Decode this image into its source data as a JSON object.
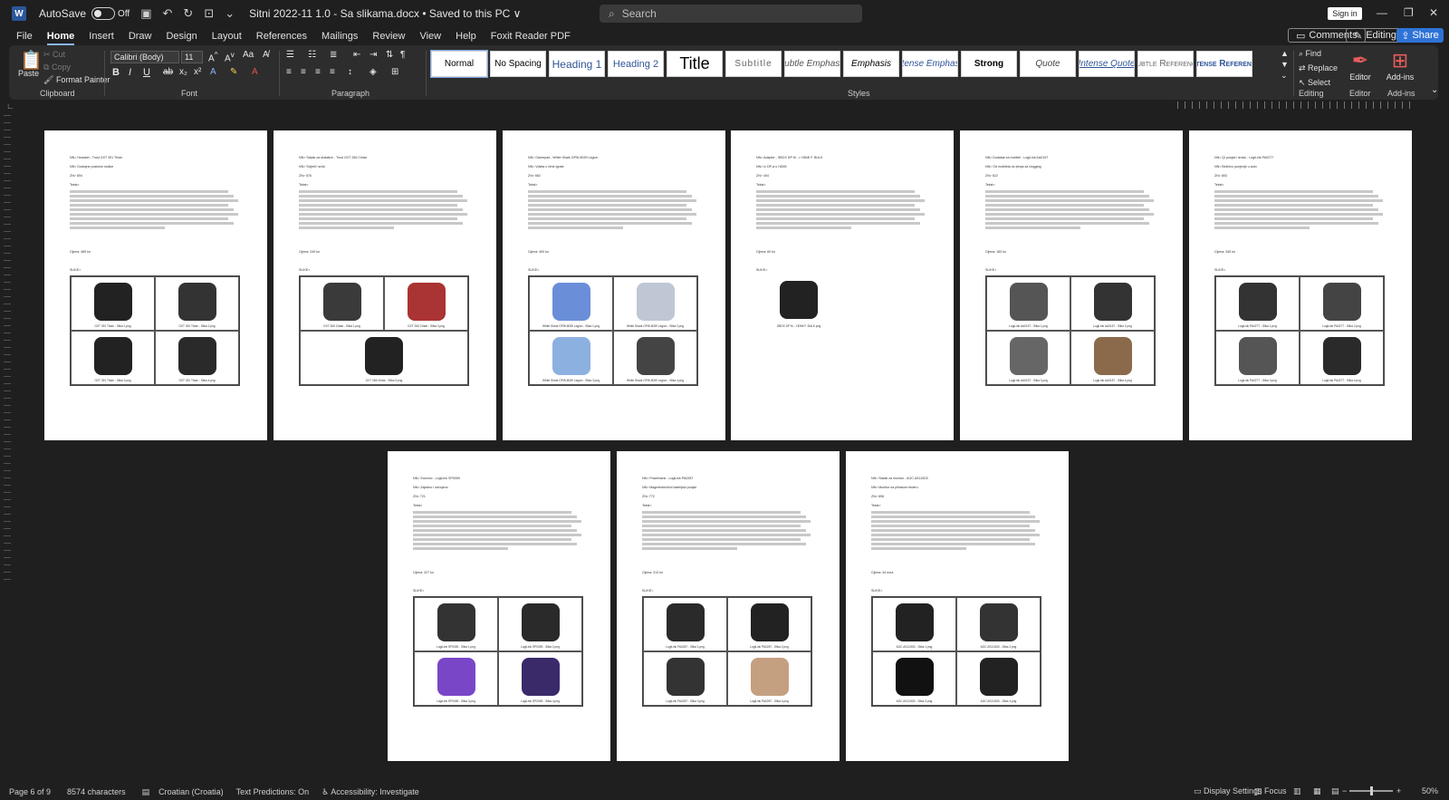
{
  "titlebar": {
    "autosave_label": "AutoSave",
    "autosave_state": "Off",
    "document_title": "Sitni 2022-11 1.0 - Sa slikama.docx • Saved to this PC ∨",
    "search_placeholder": "Search",
    "signin_label": "Sign in"
  },
  "menu": {
    "tabs": [
      "File",
      "Home",
      "Insert",
      "Draw",
      "Design",
      "Layout",
      "References",
      "Mailings",
      "Review",
      "View",
      "Help",
      "Foxit Reader PDF"
    ],
    "active_tab": "Home",
    "comments_label": "Comments",
    "editing_label": "Editing",
    "share_label": "Share"
  },
  "ribbon": {
    "clipboard": {
      "paste": "Paste",
      "cut": "Cut",
      "copy": "Copy",
      "format_painter": "Format Painter",
      "label": "Clipboard"
    },
    "font": {
      "family": "Calibri (Body)",
      "size": "11",
      "label": "Font"
    },
    "paragraph": {
      "label": "Paragraph"
    },
    "styles": {
      "label": "Styles",
      "items": [
        "Normal",
        "No Spacing",
        "Heading 1",
        "Heading 2",
        "Title",
        "Subtitle",
        "Subtle Emphasis",
        "Emphasis",
        "Intense Emphasis",
        "Strong",
        "Quote",
        "Intense Quote",
        "Subtle Reference",
        "Intense Reference"
      ]
    },
    "editing": {
      "find": "Find",
      "replace": "Replace",
      "select": "Select",
      "label": "Editing"
    },
    "editor": {
      "label": "Editor",
      "group": "Editor"
    },
    "addins": {
      "label": "Add-ins",
      "group": "Add-ins"
    }
  },
  "pages": [
    {
      "title": "NN> Headset - Trust GXT 391 Thian",
      "sub": "NN> Dostojne postoine sluške",
      "zn": "ZN> 804",
      "price": "Cijena: 489 kn",
      "captions": [
        "GXT 391 Thian - Slika 1.png",
        "GXT 391 Thian - Slika 2.png",
        "GXT 391 Thian - Slika 3.png",
        "GXT 391 Thian - Slika 4.png"
      ]
    },
    {
      "title": "NN> Stalak za slušalice - Trust GXT 265 Cintar",
      "sub": "NN> Svijetli i srčši",
      "zn": "ZN> 576",
      "price": "Cijena: 249 kn",
      "captions": [
        "GXT 265 Cintar - Slika 1.png",
        "GXT 265 Cintar - Slika 2.png",
        "GXT 265 Cintar - Slika 3.png"
      ]
    },
    {
      "title": "NN> Gamepad - White Shark GPW-8039 Legion",
      "sub": "NN> Vlakta s čime igrate",
      "zn": "ZN> 662",
      "price": "Cijena: 300 kn",
      "captions": [
        "White Shark GPW-8039 Legion - Slika 1.png",
        "White Shark GPW-8039 Legion - Slika 2.png",
        "White Shark GPW-8039 Legion - Slika 3.png",
        "White Shark GPW-8039 Legion - Slika 4.png"
      ]
    },
    {
      "title": "NN> Adapter - SBOX DP M. -> HDMI F. BULK",
      "sub": "NN> Iz DP-a u HDMI",
      "zn": "ZN> 404",
      "price": "Cijena: 60 kn",
      "captions": [
        "SBOX DP M. - HDMI F. BULK.png"
      ]
    },
    {
      "title": "NN> Dodatak za mobitel - LogiLink AA0157",
      "sub": "NN> Od mobitela do stroja za vlogging",
      "zn": "ZN> 622",
      "price": "Cijena: 183 kn",
      "captions": [
        "LogiLink AA0157 - Slika 1.png",
        "LogiLink AA0157 - Slika 2.png",
        "LogiLink AA0157 - Slika 3.png",
        "LogiLink AA0157 - Slika 4.png"
      ]
    },
    {
      "title": "NN> Qi punjač i držač - LogiLink PA0277",
      "sub": "NN> Bežično punjenje u autu",
      "zn": "ZN> 803",
      "price": "Cijena: 345 kn",
      "captions": [
        "LogiLink PA0277 - Slika 1.png",
        "LogiLink PA0277 - Slika 2.png",
        "LogiLink PA0277 - Slika 3.png",
        "LogiLink PA0277 - Slika 4.png"
      ]
    },
    {
      "title": "NN> Zvučnici - LogiLink SP0059",
      "sub": "NN> Zajedno i odvojeno",
      "zn": "ZN> 721",
      "price": "Cijena: 327 kn",
      "captions": [
        "LogiLink SP0059 - Slika 1.png",
        "LogiLink SP0059 - Slika 2.png",
        "LogiLink SP0059 - Slika 3.png",
        "LogiLink SP0059 - Slika 4.png"
      ]
    },
    {
      "title": "NN> Powerbank - LogiLink PA0287",
      "sub": "NN> Magnetobežični baterijski punjač",
      "zn": "ZN> 772",
      "price": "Cijena: 313 kn",
      "captions": [
        "LogiLink PA0287 - Slika 1.png",
        "LogiLink PA0287 - Slika 2.png",
        "LogiLink PA0287 - Slika 3.png",
        "LogiLink PA0287 - Slika 4.png"
      ]
    },
    {
      "title": "NN> Stalak za monitor - AOC AS110D0",
      "sub": "NN> Monitor na plinskom federu",
      "zn": "ZN> 898",
      "price": "Cijena: 44 eura",
      "captions": [
        "AOC AS110D0 - Slika 1.png",
        "AOC AS110D0 - Slika 2.png",
        "AOC AS110D0 - Slika 3.png",
        "AOC AS110D0 - Slika 4.png"
      ]
    }
  ],
  "labels": {
    "tekst": "Tekst>",
    "slike": "SLIKE>"
  },
  "statusbar": {
    "page": "Page 6 of 9",
    "characters": "8574 characters",
    "language": "Croatian (Croatia)",
    "predictions": "Text Predictions: On",
    "accessibility": "Accessibility: Investigate",
    "display_settings": "Display Settings",
    "focus": "Focus",
    "zoom": "50%"
  }
}
